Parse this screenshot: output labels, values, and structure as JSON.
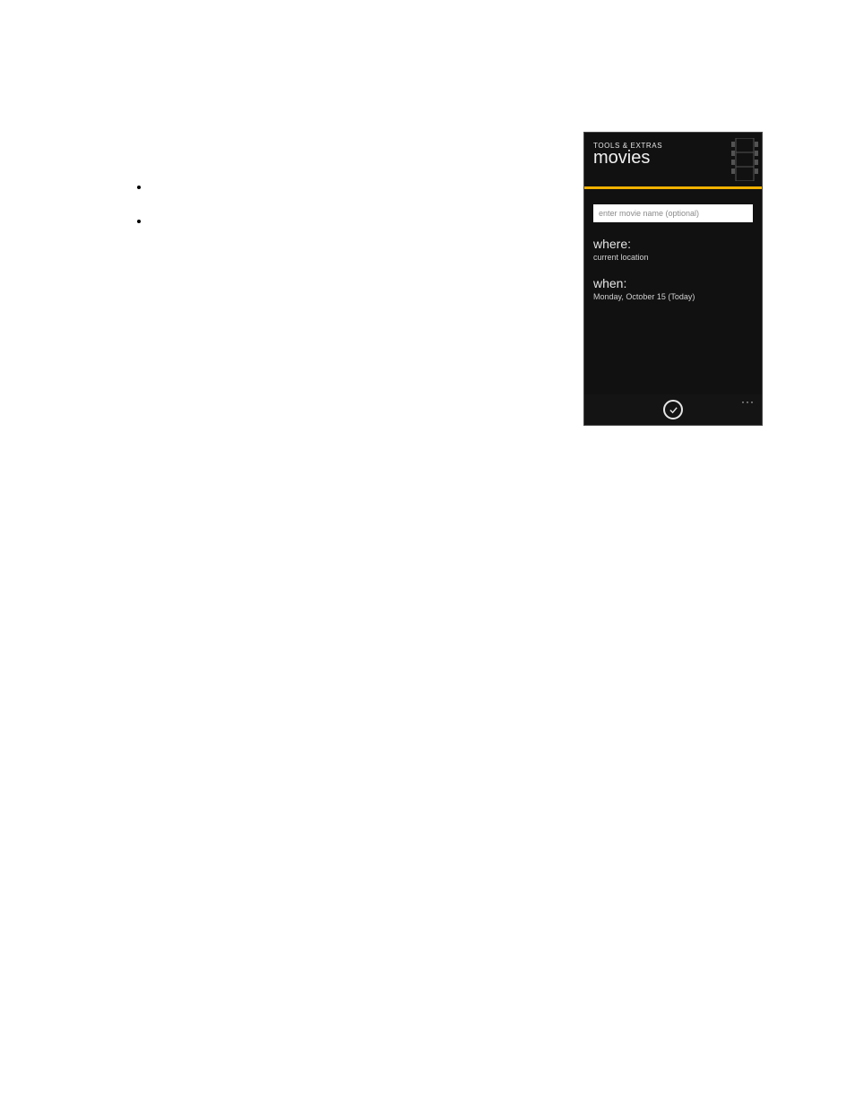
{
  "phone": {
    "header": {
      "section": "TOOLS & EXTRAS",
      "title": "movies"
    },
    "form": {
      "movie_input_placeholder": "enter movie name (optional)",
      "where_label": "where:",
      "where_value": "current location",
      "when_label": "when:",
      "when_value": "Monday, October 15 (Today)"
    },
    "appbar": {
      "more_glyph": "···"
    }
  },
  "colors": {
    "accent": "#f1b100",
    "phone_bg": "#111111",
    "text_light": "#e6e6e6"
  }
}
